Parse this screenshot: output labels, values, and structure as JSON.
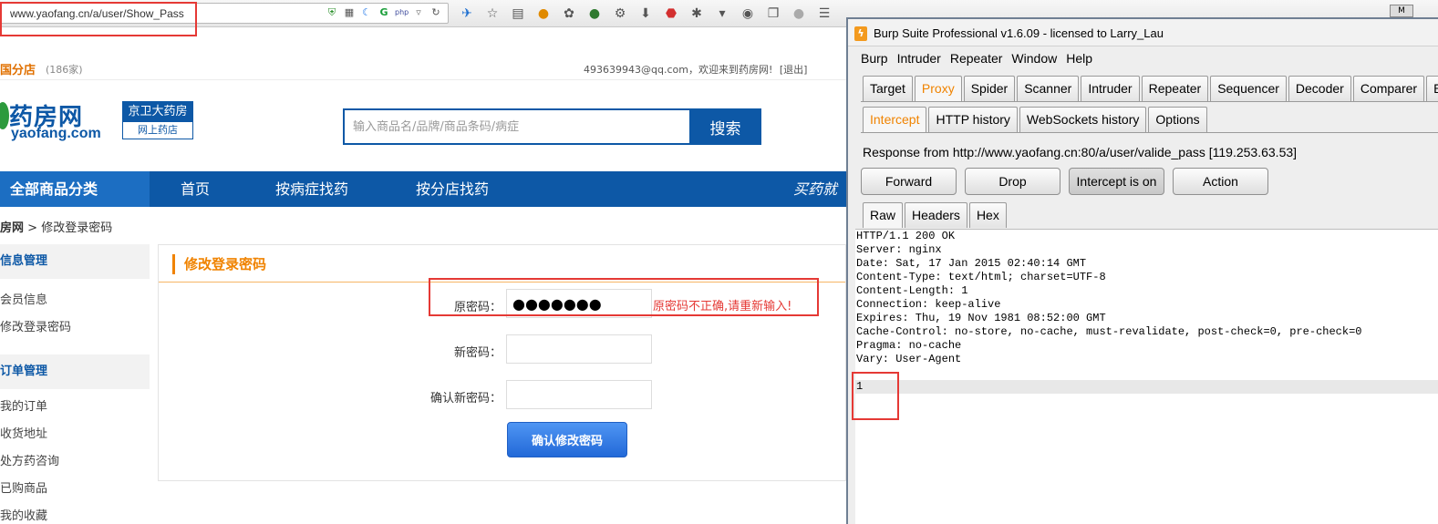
{
  "browser": {
    "url": "www.yaofang.cn/a/user/Show_Pass"
  },
  "site": {
    "region": "国分店",
    "region_count": "(186家)",
    "welcome_email": "493639943@qq.com",
    "welcome_text": "，欢迎来到药房网!",
    "logout": "[退出]",
    "logo_main": "药房网",
    "logo_sub": "yaofang.com",
    "badge_top": "京卫大药房",
    "badge_bottom": "网上药店",
    "search_placeholder": "输入商品名/品牌/商品条码/病症",
    "search_button": "搜索",
    "nav_all": "全部商品分类",
    "nav": [
      "首页",
      "按病症找药",
      "按分店找药"
    ],
    "nav_slogan": "买药就",
    "breadcrumb_home": "房网",
    "breadcrumb_sep": " > ",
    "breadcrumb_current": "修改登录密码",
    "sidebar": {
      "head1": "信息管理",
      "items1": [
        "会员信息",
        "修改登录密码"
      ],
      "head2": "订单管理",
      "items2": [
        "我的订单",
        "收货地址",
        "处方药咨询",
        "已购商品",
        "我的收藏"
      ]
    },
    "content_title": "修改登录密码",
    "form": {
      "old_label": "原密码：",
      "old_value": "●●●●●●●",
      "error": "原密码不正确,请重新输入!",
      "new_label": "新密码：",
      "confirm_label": "确认新密码：",
      "submit": "确认修改密码"
    }
  },
  "burp": {
    "title": "Burp Suite Professional v1.6.09 - licensed to Larry_Lau",
    "menu": [
      "Burp",
      "Intruder",
      "Repeater",
      "Window",
      "Help"
    ],
    "tabs_main": [
      "Target",
      "Proxy",
      "Spider",
      "Scanner",
      "Intruder",
      "Repeater",
      "Sequencer",
      "Decoder",
      "Comparer",
      "Extender"
    ],
    "tabs_sub": [
      "Intercept",
      "HTTP history",
      "WebSockets history",
      "Options"
    ],
    "response_info": "Response from http://www.yaofang.cn:80/a/user/valide_pass  [119.253.63.53]",
    "buttons": [
      "Forward",
      "Drop",
      "Intercept is on",
      "Action"
    ],
    "tabs_view": [
      "Raw",
      "Headers",
      "Hex"
    ],
    "response_lines": [
      "HTTP/1.1 200 OK",
      "Server: nginx",
      "Date: Sat, 17 Jan 2015 02:40:14 GMT",
      "Content-Type: text/html; charset=UTF-8",
      "Content-Length: 1",
      "Connection: keep-alive",
      "Expires: Thu, 19 Nov 1981 08:52:00 GMT",
      "Cache-Control: no-store, no-cache, must-revalidate, post-check=0, pre-check=0",
      "Pragma: no-cache",
      "Vary: User-Agent",
      "",
      "1"
    ]
  },
  "colors": {
    "brand_blue": "#0d58a6",
    "accent_orange": "#f08300",
    "error_red": "#e53935"
  }
}
